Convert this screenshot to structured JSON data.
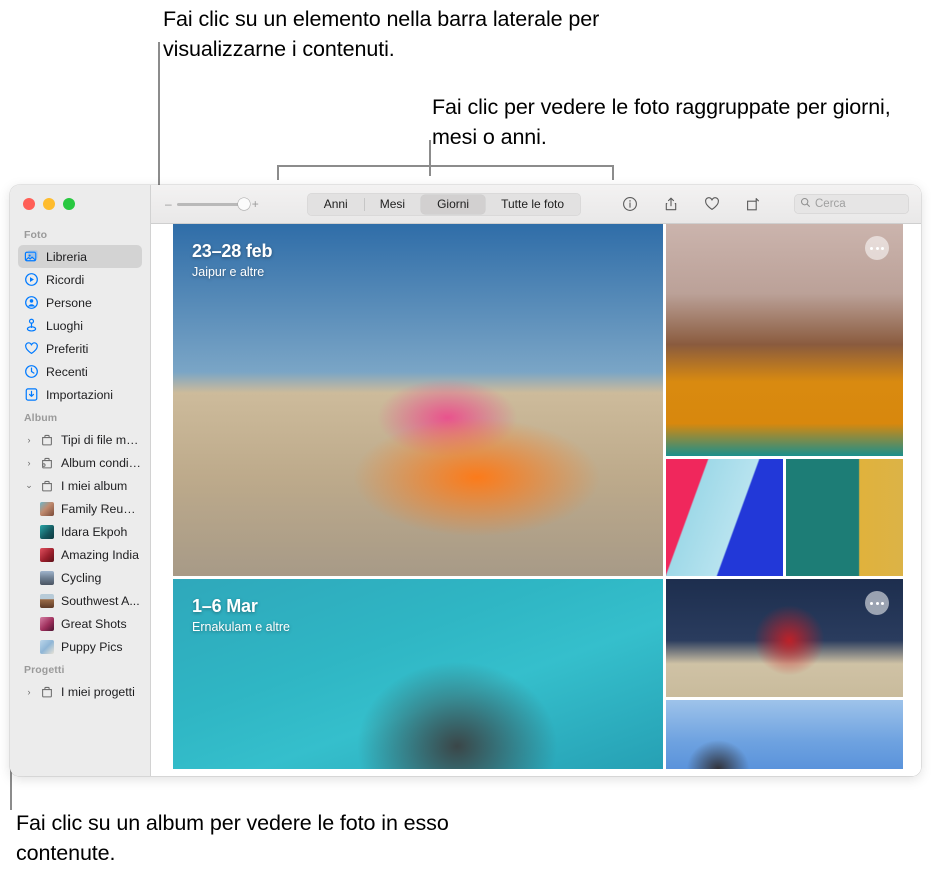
{
  "callouts": {
    "sidebar": "Fai clic su un elemento nella barra laterale per visualizzarne i contenuti.",
    "grouping": "Fai clic per vedere le foto raggruppate per giorni, mesi o anni.",
    "album": "Fai clic su un album per vedere le foto in esso contenute."
  },
  "window": {
    "traffic_lights": {
      "close": "close-button",
      "minimize": "minimize-button",
      "zoom": "zoom-button"
    }
  },
  "toolbar": {
    "zoom_slider": {
      "minus": "–",
      "plus": "+",
      "value": 92
    },
    "segments": [
      {
        "label": "Anni",
        "active": false
      },
      {
        "label": "Mesi",
        "active": false
      },
      {
        "label": "Giorni",
        "active": true
      },
      {
        "label": "Tutte le foto",
        "active": false
      }
    ],
    "icons": [
      {
        "name": "info-icon",
        "glyph": "ⓘ"
      },
      {
        "name": "share-icon",
        "glyph": "⇧"
      },
      {
        "name": "favorite-heart-icon",
        "glyph": "♡"
      },
      {
        "name": "rotate-icon",
        "glyph": "↻"
      }
    ],
    "search": {
      "placeholder": "Cerca",
      "value": "",
      "icon": "search-icon"
    }
  },
  "sidebar": {
    "sections": [
      {
        "header": "Foto",
        "items": [
          {
            "label": "Libreria",
            "icon": "photos-library-icon",
            "selected": true
          },
          {
            "label": "Ricordi",
            "icon": "memories-icon",
            "selected": false
          },
          {
            "label": "Persone",
            "icon": "people-icon",
            "selected": false
          },
          {
            "label": "Luoghi",
            "icon": "places-pin-icon",
            "selected": false
          },
          {
            "label": "Preferiti",
            "icon": "heart-icon",
            "selected": false
          },
          {
            "label": "Recenti",
            "icon": "clock-icon",
            "selected": false
          },
          {
            "label": "Importazioni",
            "icon": "import-icon",
            "selected": false
          }
        ]
      },
      {
        "header": "Album",
        "items": [
          {
            "label": "Tipi di file multi...",
            "icon": "folder-icon",
            "disclosure": "›",
            "selected": false
          },
          {
            "label": "Album condivisi",
            "icon": "shared-album-icon",
            "disclosure": "›",
            "selected": false
          },
          {
            "label": "I miei album",
            "icon": "folder-icon",
            "disclosure": "⌄",
            "selected": false
          }
        ],
        "children": [
          {
            "label": "Family Reuni...",
            "thumb": "#c08a6e"
          },
          {
            "label": "Idara Ekpoh",
            "thumb": "#1f7f84"
          },
          {
            "label": "Amazing India",
            "thumb": "#b02b3a"
          },
          {
            "label": "Cycling",
            "thumb": "#8a99ad"
          },
          {
            "label": "Southwest A...",
            "thumb": "#7c5b43"
          },
          {
            "label": "Great Shots",
            "thumb": "#a6395f"
          },
          {
            "label": "Puppy Pics",
            "thumb": "#9fbcd6"
          }
        ]
      },
      {
        "header": "Progetti",
        "items": [
          {
            "label": "I miei progetti",
            "icon": "folder-icon",
            "disclosure": "›",
            "selected": false
          }
        ]
      }
    ]
  },
  "grid": {
    "groups": [
      {
        "date": "23–28 feb",
        "place": "Jaipur e altre",
        "hero": {
          "name": "photo-dancer-pavilion",
          "alt": "Donna che danza sotto un padiglione nel deserto"
        },
        "side_large": {
          "name": "photo-woman-yellow-shawl",
          "alt": "Donna sorridente con scialle giallo"
        },
        "side_pair": [
          {
            "name": "photo-man-sunglasses",
            "alt": "Uomo con occhiali da sole su sfondo colorato"
          },
          {
            "name": "photo-woman-green-door",
            "alt": "Donna davanti a una porta verde"
          }
        ],
        "more_button": "more-options-button"
      },
      {
        "date": "1–6 Mar",
        "place": "Ernakulam e altre",
        "hero": {
          "name": "photo-swimmer",
          "alt": "Persona che nuota in piscina"
        },
        "side_large": {
          "name": "photo-cyclist-red-helmet",
          "alt": "Ciclista con casco rosso e sciarpa rossa"
        },
        "side_pair": [
          {
            "name": "photo-sky-portrait",
            "alt": "Ritratto contro il cielo azzurro"
          }
        ],
        "more_button": "more-options-button"
      }
    ]
  },
  "colors": {
    "accent": "#007aff",
    "sidebar_bg": "#ececec",
    "selected_row": "#d3d3d3",
    "toolbar_bg": "#efeeee",
    "callout_line": "#8c8c8c"
  }
}
